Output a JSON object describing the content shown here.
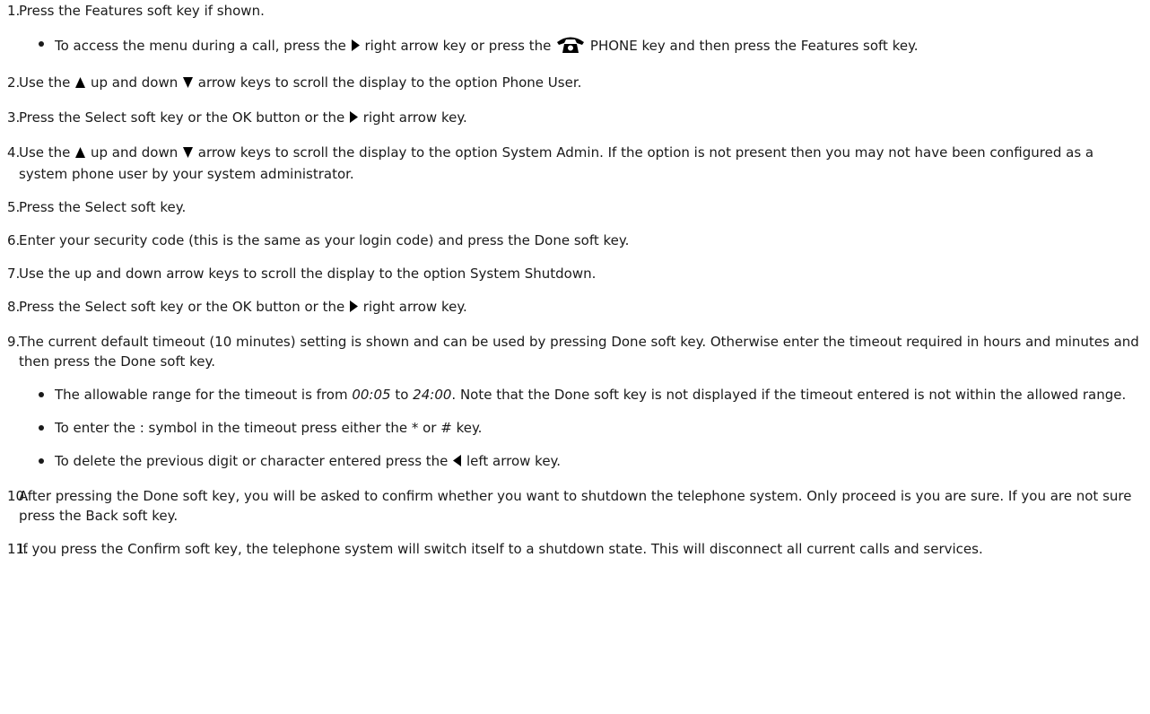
{
  "steps": [
    {
      "num": "1.",
      "parts": [
        {
          "t": "Press the Features soft key if shown."
        }
      ],
      "sub": [
        [
          {
            "t": "To access the menu during a call, press the "
          },
          {
            "icon": "right-arrow-icon"
          },
          {
            "t": " right arrow key or press the "
          },
          {
            "icon": "phone-icon"
          },
          {
            "t": " PHONE key and then press the Features soft key."
          }
        ]
      ]
    },
    {
      "num": "2.",
      "parts": [
        {
          "t": "Use the "
        },
        {
          "icon": "up-arrow-icon"
        },
        {
          "t": " up and down "
        },
        {
          "icon": "down-arrow-icon"
        },
        {
          "t": " arrow keys to scroll the display to the option Phone User."
        }
      ]
    },
    {
      "num": "3.",
      "parts": [
        {
          "t": "Press the Select soft key or the OK button or the "
        },
        {
          "icon": "right-arrow-icon"
        },
        {
          "t": " right arrow key."
        }
      ]
    },
    {
      "num": "4.",
      "parts": [
        {
          "t": "Use the "
        },
        {
          "icon": "up-arrow-icon"
        },
        {
          "t": " up and down "
        },
        {
          "icon": "down-arrow-icon"
        },
        {
          "t": " arrow keys to scroll the display to the option System Admin. If the option is not present then you may not have been configured as a system phone user by your system administrator."
        }
      ]
    },
    {
      "num": "5.",
      "parts": [
        {
          "t": "Press the Select soft key."
        }
      ]
    },
    {
      "num": "6.",
      "parts": [
        {
          "t": "Enter your security code (this is the same as your login code) and press the Done soft key."
        }
      ]
    },
    {
      "num": "7.",
      "parts": [
        {
          "t": "Use the up and down arrow keys to scroll the display to the option System Shutdown."
        }
      ]
    },
    {
      "num": "8.",
      "parts": [
        {
          "t": "Press the Select soft key or the OK button or the "
        },
        {
          "icon": "right-arrow-icon"
        },
        {
          "t": " right arrow key."
        }
      ]
    },
    {
      "num": "9.",
      "parts": [
        {
          "t": "The current default timeout (10 minutes) setting is shown and can be used by pressing Done soft key. Otherwise enter the timeout required in hours and minutes and then press the Done soft key."
        }
      ],
      "sub": [
        [
          {
            "t": "The allowable range for the timeout is from "
          },
          {
            "t": "00:05",
            "italic": true
          },
          {
            "t": " to "
          },
          {
            "t": "24:00",
            "italic": true
          },
          {
            "t": ". Note that the Done soft key is not displayed if the timeout entered is not within the allowed range."
          }
        ],
        [
          {
            "t": "To enter the : symbol in the timeout press either the * or # key."
          }
        ],
        [
          {
            "t": "To delete the previous digit or character entered press the "
          },
          {
            "icon": "left-arrow-icon"
          },
          {
            "t": " left arrow key."
          }
        ]
      ]
    },
    {
      "num": "10.",
      "parts": [
        {
          "t": "After pressing the Done soft key, you will be asked to confirm whether you want to shutdown the telephone system. Only proceed is you are sure. If you are not sure press the Back soft key."
        }
      ]
    },
    {
      "num": "11.",
      "parts": [
        {
          "t": "If you press the Confirm soft key, the telephone system will switch itself to a shutdown state. This will disconnect all current calls and services."
        }
      ]
    }
  ]
}
